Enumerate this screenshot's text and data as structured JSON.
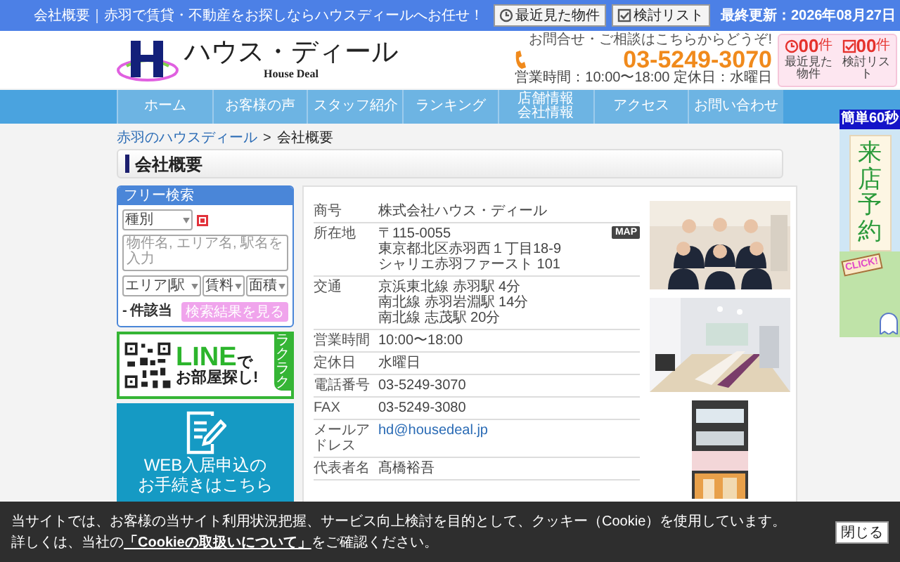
{
  "top_bar": {
    "tagline": "会社概要｜赤羽で賃貸・不動産をお探しならハウスディールへお任せ！",
    "buttons": [
      {
        "kind": "recent",
        "label": "最近見た物件"
      },
      {
        "kind": "favorites",
        "label": "検討リスト"
      }
    ],
    "last_updated": "最終更新：2026年08月27日"
  },
  "header": {
    "logo_name": "ハウス・ディール",
    "logo_sub": "House Deal",
    "contact_lead": "お問合せ・ご相談はこちらからどうぞ!",
    "phone": "03-5249-3070",
    "hours": "営業時間：10:00〜18:00 定休日：水曜日",
    "counters": [
      {
        "kind": "recent",
        "count": "00",
        "unit": "件",
        "label": "最近見た物件"
      },
      {
        "kind": "favorites",
        "count": "00",
        "unit": "件",
        "label": "検討リスト"
      }
    ]
  },
  "nav": [
    [
      "ホーム"
    ],
    [
      "お客様の声"
    ],
    [
      "スタッフ紹介"
    ],
    [
      "ランキング"
    ],
    [
      "店舗情報",
      "会社情報"
    ],
    [
      "アクセス"
    ],
    [
      "お問い合わせ"
    ]
  ],
  "breadcrumb": {
    "link": "赤羽のハウスディール",
    "separator": ">",
    "current": "会社概要"
  },
  "page_title": "会社概要",
  "search": {
    "title": "フリー検索",
    "type_select": "種別",
    "keyword_placeholder": "物件名, エリア名, 駅名を入力",
    "filters": [
      "エリア|駅",
      "賃料",
      "面積"
    ],
    "count": "-",
    "count_label": "件該当",
    "button": "検索結果を見る"
  },
  "line_banner": {
    "badge": "ラクラク",
    "brand": "LINE",
    "suffix": "で",
    "text": "お部屋探し!"
  },
  "web_banner": {
    "lines": [
      "WEB入居申込の",
      "お手続きはこちら"
    ]
  },
  "company": [
    {
      "label": "商号",
      "kind": "text",
      "lines": [
        "株式会社ハウス・ディール"
      ]
    },
    {
      "label": "所在地",
      "kind": "text",
      "lines": [
        "〒115-0055",
        "東京都北区赤羽西１丁目18-9",
        "シャリエ赤羽ファースト 101"
      ],
      "badge": "MAP"
    },
    {
      "label": "交通",
      "kind": "text",
      "lines": [
        "京浜東北線 赤羽駅 4分",
        "南北線 赤羽岩淵駅 14分",
        "南北線 志茂駅 20分"
      ]
    },
    {
      "label": "営業時間",
      "kind": "text",
      "lines": [
        "10:00〜18:00"
      ]
    },
    {
      "label": "定休日",
      "kind": "text",
      "lines": [
        "水曜日"
      ]
    },
    {
      "label": "電話番号",
      "kind": "text",
      "lines": [
        "03-5249-3070"
      ]
    },
    {
      "label": "FAX",
      "kind": "text",
      "lines": [
        "03-5249-3080"
      ]
    },
    {
      "label": "メールアドレス",
      "kind": "link",
      "lines": [
        "hd@housedeal.jp"
      ]
    },
    {
      "label": "代表者名",
      "kind": "text",
      "lines": [
        "髙橋裕吾"
      ]
    }
  ],
  "reserve_banner": {
    "tag": "簡単60秒",
    "title": "来店予約",
    "sign": "CLICK!"
  },
  "cookie_notice": {
    "text": "当サイトでは、お客様の当サイト利用状況把握、サービス向上検討を目的として、クッキー（Cookie）を使用しています。",
    "detail_before": "詳しくは、当社の",
    "link": "「Cookieの取扱いについて」",
    "detail_after": "をご確認ください。",
    "button": "閉じる"
  }
}
